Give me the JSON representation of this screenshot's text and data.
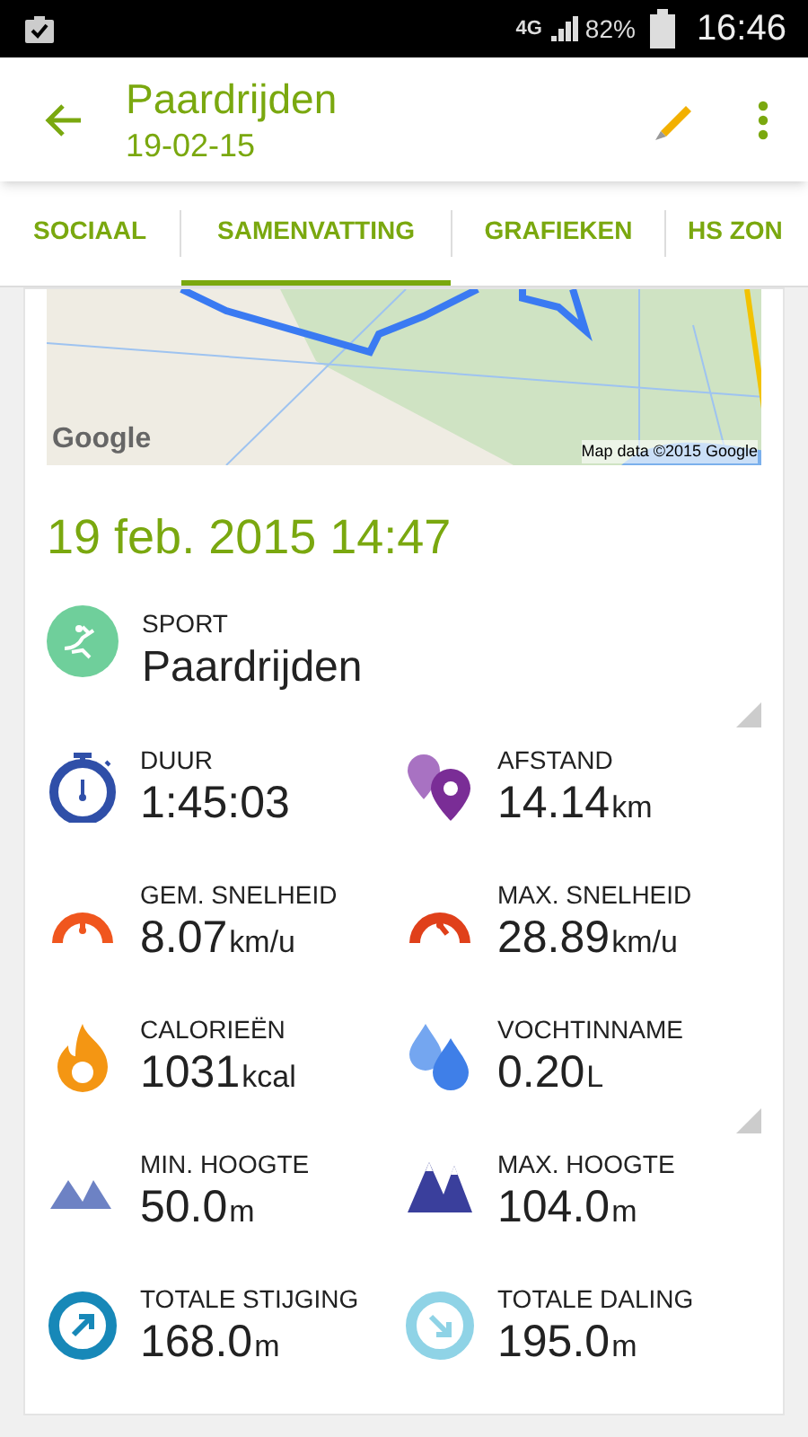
{
  "status_bar": {
    "network": "4G",
    "battery": "82%",
    "time": "16:46"
  },
  "app_bar": {
    "title": "Paardrijden",
    "subtitle": "19-02-15"
  },
  "tabs": [
    {
      "label": "SOCIAAL",
      "selected": false
    },
    {
      "label": "SAMENVATTING",
      "selected": true
    },
    {
      "label": "GRAFIEKEN",
      "selected": false
    },
    {
      "label": "HS ZON",
      "selected": false
    }
  ],
  "map": {
    "logo": "Google",
    "attribution": "Map data ©2015 Google"
  },
  "start_time": "19 feb. 2015 14:47",
  "sport": {
    "label": "SPORT",
    "value": "Paardrijden"
  },
  "stats": [
    {
      "kind": "duration",
      "label": "DUUR",
      "value": "1:45:03"
    },
    {
      "kind": "distance",
      "label": "AFSTAND",
      "value": "14.14",
      "unit": "km"
    },
    {
      "kind": "avg_speed",
      "label": "GEM. SNELHEID",
      "value": "8.07",
      "unit": "km/u"
    },
    {
      "kind": "max_speed",
      "label": "MAX. SNELHEID",
      "value": "28.89",
      "unit": "km/u"
    },
    {
      "kind": "calories",
      "label": "CALORIEËN",
      "value": "1031",
      "unit": "kcal"
    },
    {
      "kind": "hydration",
      "label": "VOCHTINNAME",
      "value": "0.20",
      "unit": "L"
    },
    {
      "kind": "min_altitude",
      "label": "MIN. HOOGTE",
      "value": "50.0",
      "unit": "m"
    },
    {
      "kind": "max_altitude",
      "label": "MAX. HOOGTE",
      "value": "104.0",
      "unit": "m"
    },
    {
      "kind": "ascent",
      "label": "TOTALE STIJGING",
      "value": "168.0",
      "unit": "m"
    },
    {
      "kind": "descent",
      "label": "TOTALE DALING",
      "value": "195.0",
      "unit": "m"
    }
  ]
}
